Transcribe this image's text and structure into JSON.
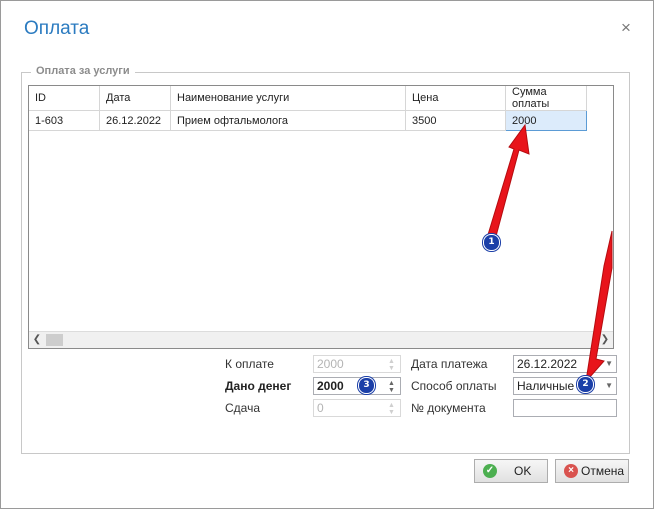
{
  "window": {
    "title": "Оплата",
    "close_glyph": "×"
  },
  "group": {
    "legend": "Оплата за услуги"
  },
  "grid": {
    "columns": [
      "ID",
      "Дата",
      "Наименование услуги",
      "Цена",
      "Сумма оплаты"
    ],
    "rows": [
      {
        "id": "1-603",
        "date": "26.12.2022",
        "service": "Прием офтальмолога",
        "price": "3500",
        "amount": "2000"
      }
    ]
  },
  "form": {
    "to_pay": {
      "label": "К оплате",
      "value": "2000"
    },
    "given": {
      "label": "Дано денег",
      "value": "2000"
    },
    "change": {
      "label": "Сдача",
      "value": "0"
    },
    "payment_date": {
      "label": "Дата платежа",
      "value": "26.12.2022"
    },
    "payment_method": {
      "label": "Способ оплаты",
      "value": "Наличные"
    },
    "document_no": {
      "label": "№ документа",
      "value": ""
    }
  },
  "buttons": {
    "ok": "OK",
    "cancel": "Отмена"
  },
  "annotations": [
    "1",
    "2",
    "3"
  ],
  "colors": {
    "title": "#2b7bc0",
    "badge": "#1b3fa8",
    "arrow": "#e8141b",
    "ok_icon": "#4caf50",
    "cancel_icon": "#d9534f"
  }
}
